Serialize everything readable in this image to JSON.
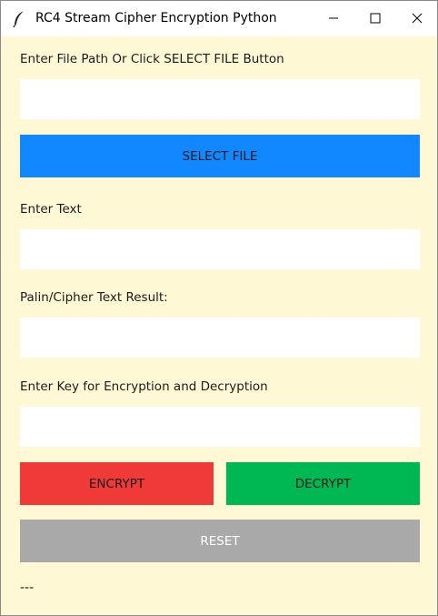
{
  "window": {
    "title": "RC4 Stream Cipher Encryption Python",
    "icon": "feather-icon",
    "controls": [
      "minimize-icon",
      "maximize-icon",
      "close-icon"
    ]
  },
  "file_path": {
    "label": "Enter File Path Or Click SELECT FILE Button",
    "value": ""
  },
  "select_file": {
    "label": "SELECT FILE",
    "color": "#1188ff"
  },
  "text": {
    "label": "Enter Text",
    "value": ""
  },
  "result": {
    "label": "Palin/Cipher Text Result:",
    "value": ""
  },
  "key": {
    "label": "Enter Key for Encryption and Decryption",
    "value": ""
  },
  "encrypt": {
    "label": "ENCRYPT",
    "color": "#ef3a38"
  },
  "decrypt": {
    "label": "DECRYPT",
    "color": "#00b853"
  },
  "reset": {
    "label": "RESET",
    "color": "#a9a9a9",
    "text_color": "#ffffff"
  },
  "status_text": "---",
  "colors": {
    "background": "#fff8d5",
    "field": "#ffffff"
  }
}
